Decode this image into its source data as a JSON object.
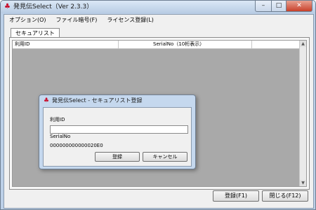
{
  "window": {
    "title": "発見伝Select（Ver 2.3.3）",
    "icon": "app-logo-icon"
  },
  "menu": [
    "オプション(O)",
    "ファイル暗号(F)",
    "ライセンス登録(L)"
  ],
  "tab": {
    "label": "セキュアリスト"
  },
  "list": {
    "columns": [
      "利用ID",
      "SerialNo（10桁表示）"
    ]
  },
  "buttons": {
    "register": "登録(F1)",
    "close": "閉じる(F12)"
  },
  "dialog": {
    "title": "発見伝Select - セキュアリスト登録",
    "user_id_label": "利用ID",
    "user_id_value": "",
    "serial_label": "SerialNo",
    "serial_value": "000000000000020E0",
    "register_label": "登録",
    "cancel_label": "キャンセル"
  },
  "colors": {
    "window_frame": "#bcd0e8",
    "list_background": "#a9a9a9",
    "close_button": "#c8402a"
  }
}
